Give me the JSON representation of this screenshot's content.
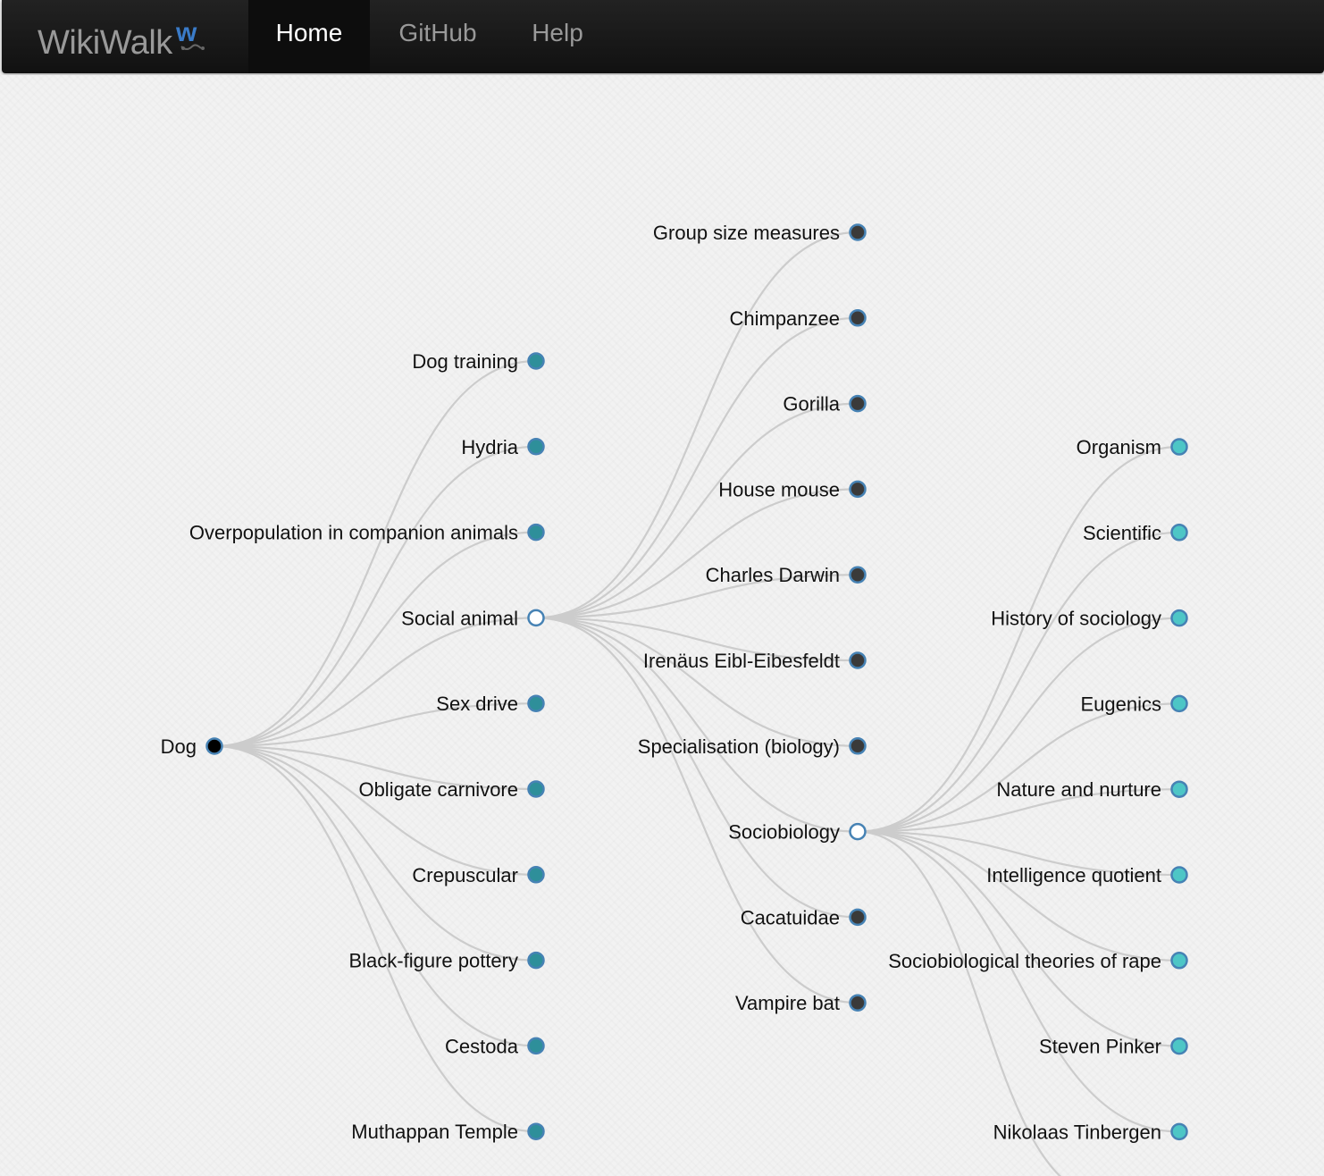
{
  "navbar": {
    "brand": "WikiWalk",
    "items": [
      {
        "label": "Home",
        "active": true
      },
      {
        "label": "GitHub",
        "active": false
      },
      {
        "label": "Help",
        "active": false
      }
    ]
  },
  "colors": {
    "link": "#cccccc",
    "root_fill": "#000000",
    "level1_fill": "#2e8f9a",
    "level2_fill": "#3a3a3a",
    "level3_fill": "#4dc6c6",
    "node_stroke": "#4682b4",
    "expanded_fill": "#ffffff"
  },
  "tree": {
    "root": "Dog",
    "level1": [
      "Dog training",
      "Hydria",
      "Overpopulation in companion animals",
      "Social animal",
      "Sex drive",
      "Obligate carnivore",
      "Crepuscular",
      "Black-figure pottery",
      "Cestoda",
      "Muthappan Temple"
    ],
    "level1_expanded": "Social animal",
    "level2": [
      "Group size measures",
      "Chimpanzee",
      "Gorilla",
      "House mouse",
      "Charles Darwin",
      "Irenäus Eibl-Eibesfeldt",
      "Specialisation (biology)",
      "Sociobiology",
      "Cacatuidae",
      "Vampire bat"
    ],
    "level2_expanded": "Sociobiology",
    "level3": [
      "Organism",
      "Scientific",
      "History of sociology",
      "Eugenics",
      "Nature and nurture",
      "Intelligence quotient",
      "Sociobiological theories of rape",
      "Steven Pinker",
      "Nikolaas Tinbergen"
    ]
  }
}
